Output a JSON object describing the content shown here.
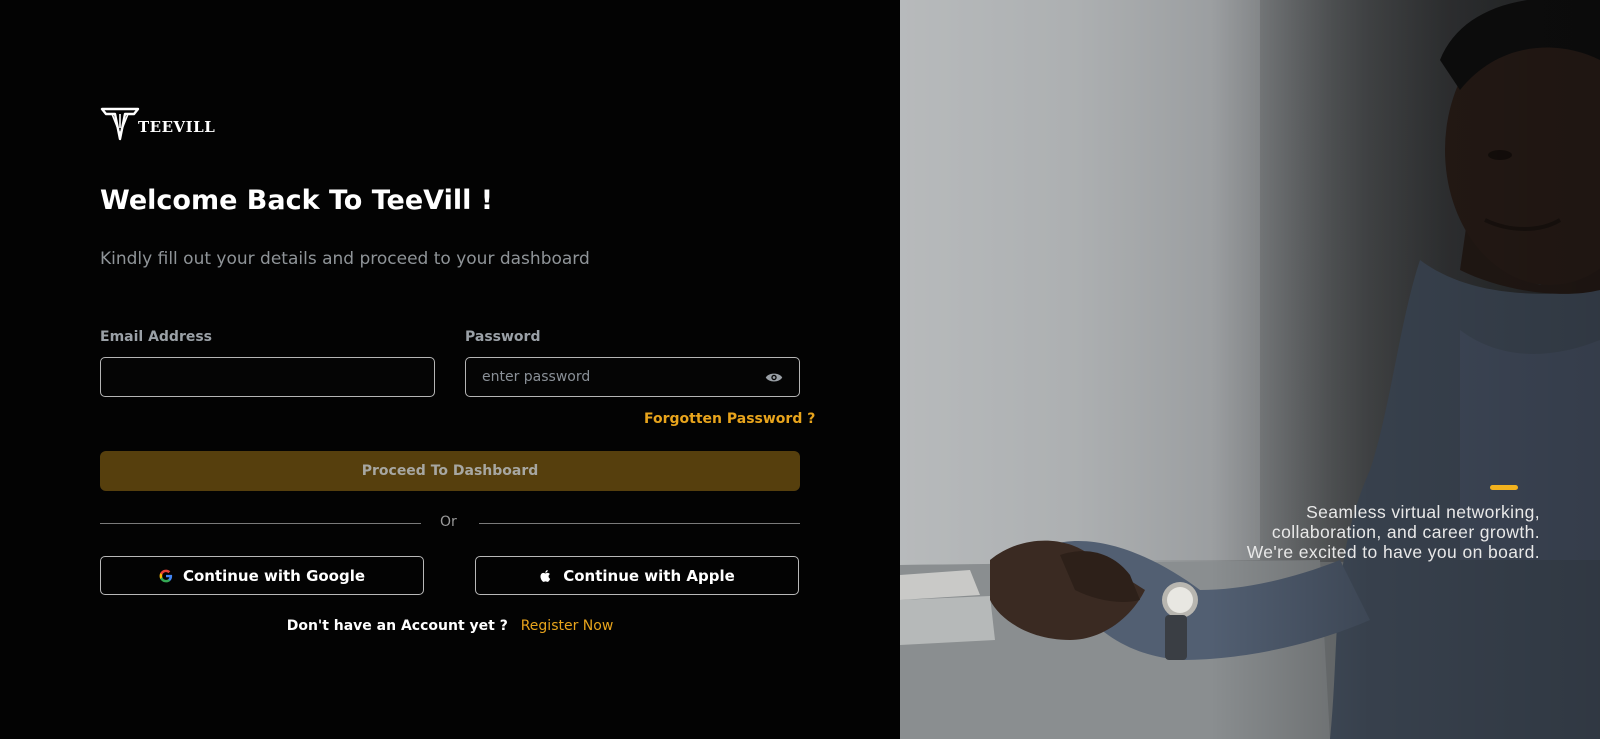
{
  "brand": {
    "logo_text": "TEEVILL"
  },
  "login": {
    "title": "Welcome Back To TeeVill !",
    "subtitle": "Kindly fill out your details and proceed to your dashboard",
    "email_label": "Email Address",
    "email_value": "",
    "email_placeholder": "",
    "password_label": "Password",
    "password_placeholder": "enter password",
    "forgot_label": "Forgotten Password ?",
    "proceed_label": "Proceed To Dashboard",
    "divider_label": "Or",
    "google_label": "Continue with Google",
    "apple_label": "Continue with Apple",
    "no_account_text": "Don't have an Account yet ?",
    "register_label": "Register Now"
  },
  "hero": {
    "tagline_lines": [
      "Seamless virtual networking,",
      "collaboration, and career growth.",
      "We're excited to have you on board."
    ]
  },
  "colors": {
    "accent": "#e8a41c",
    "button_disabled": "#563f0d",
    "background": "#030303"
  },
  "icons": {
    "password_toggle": "eye-icon",
    "google": "google-icon",
    "apple": "apple-icon"
  }
}
